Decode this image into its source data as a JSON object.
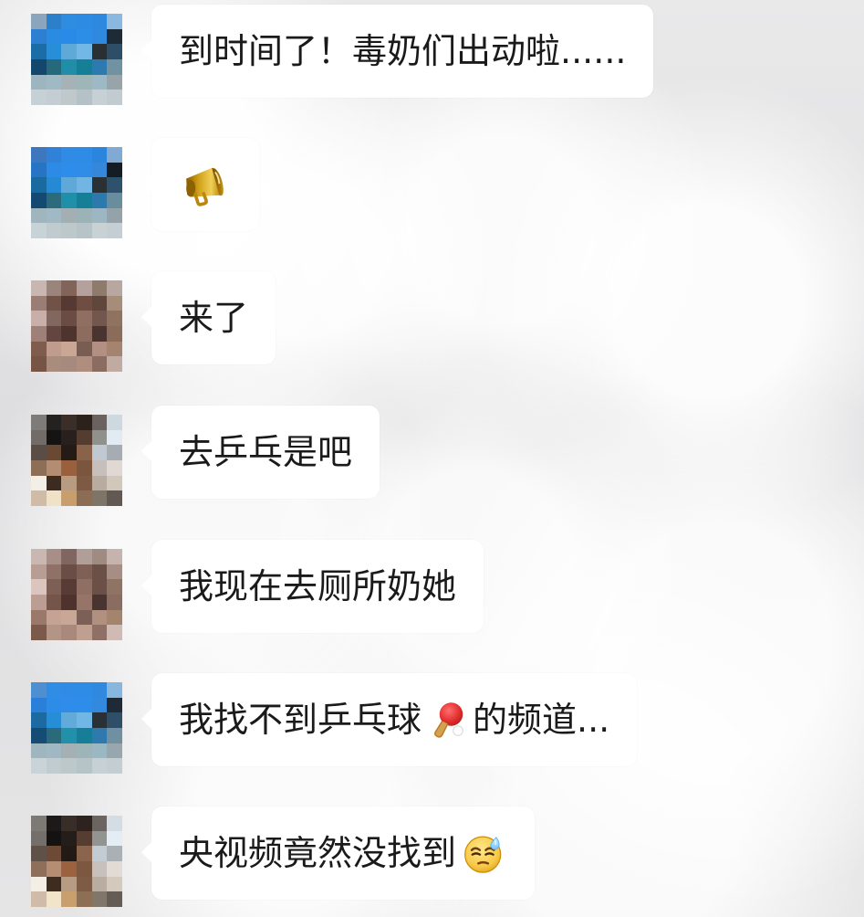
{
  "messages": [
    {
      "text": "到时间了！毒奶们出动啦......"
    },
    {
      "icon": "megaphone-icon"
    },
    {
      "text": "来了"
    },
    {
      "text": "去乒乓是吧"
    },
    {
      "text": "我现在去厕所奶她"
    },
    {
      "text_before": "我找不到乒乓球",
      "icon": "ping-pong-icon",
      "text_after": "的频道..."
    },
    {
      "text": "央视频竟然没找到",
      "icon": "sweat-smile-icon"
    }
  ],
  "colors": {
    "bubble": "#ffffff",
    "text": "#1a1a1a"
  }
}
